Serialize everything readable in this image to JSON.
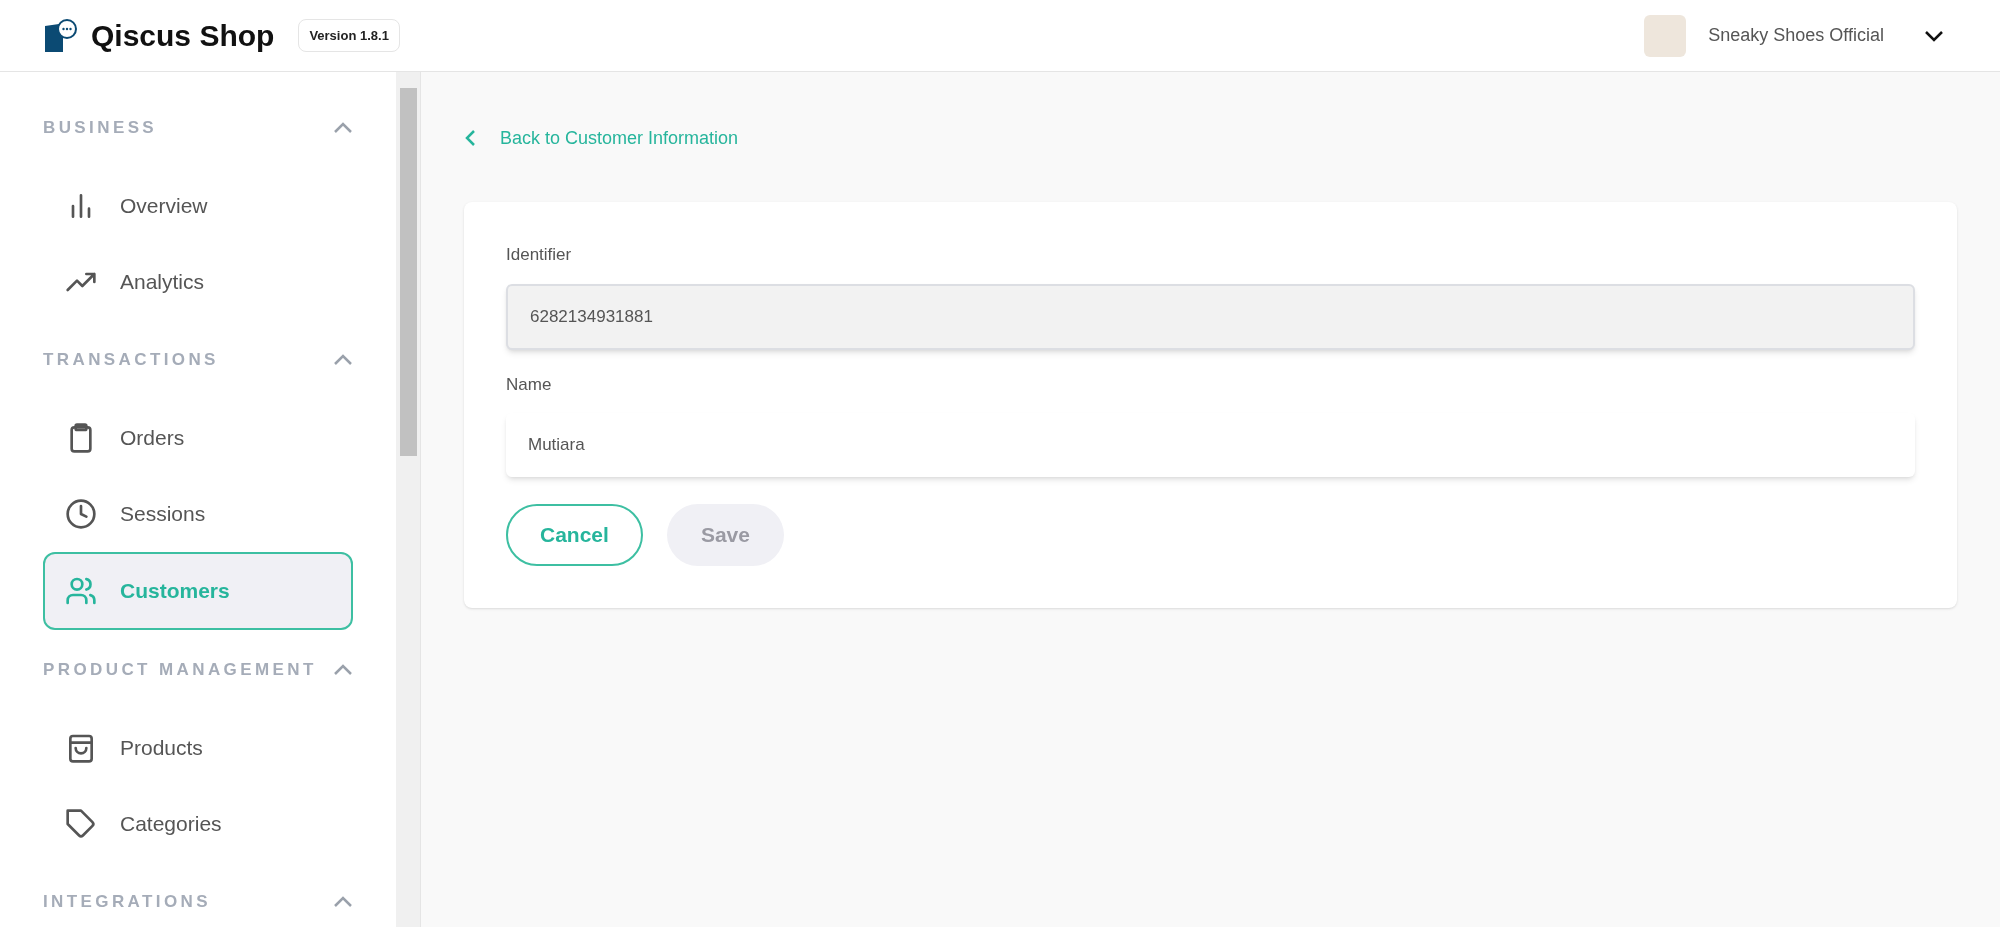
{
  "header": {
    "brand": "Qiscus Shop",
    "version": "Version 1.8.1",
    "user_name": "Sneaky Shoes Official"
  },
  "sidebar": {
    "sections": [
      {
        "title": "BUSINESS",
        "expanded": true,
        "items": [
          {
            "label": "Overview",
            "selected": false
          },
          {
            "label": "Analytics",
            "selected": false
          }
        ]
      },
      {
        "title": "TRANSACTIONS",
        "expanded": true,
        "items": [
          {
            "label": "Orders",
            "selected": false
          },
          {
            "label": "Sessions",
            "selected": false
          },
          {
            "label": "Customers",
            "selected": true
          }
        ]
      },
      {
        "title": "PRODUCT MANAGEMENT",
        "expanded": true,
        "items": [
          {
            "label": "Products",
            "selected": false
          },
          {
            "label": "Categories",
            "selected": false
          }
        ]
      },
      {
        "title": "INTEGRATIONS",
        "expanded": true
      }
    ]
  },
  "back_link": "Back to Customer Information",
  "form": {
    "fields": [
      {
        "label": "Identifier",
        "value": "6282134931881",
        "disabled": true
      },
      {
        "label": "Name",
        "value": "Mutiara",
        "disabled": false
      }
    ],
    "buttons": [
      {
        "label": "Cancel",
        "kind": "outline",
        "disabled": false
      },
      {
        "label": "Save",
        "kind": "primary",
        "disabled": true
      }
    ]
  }
}
